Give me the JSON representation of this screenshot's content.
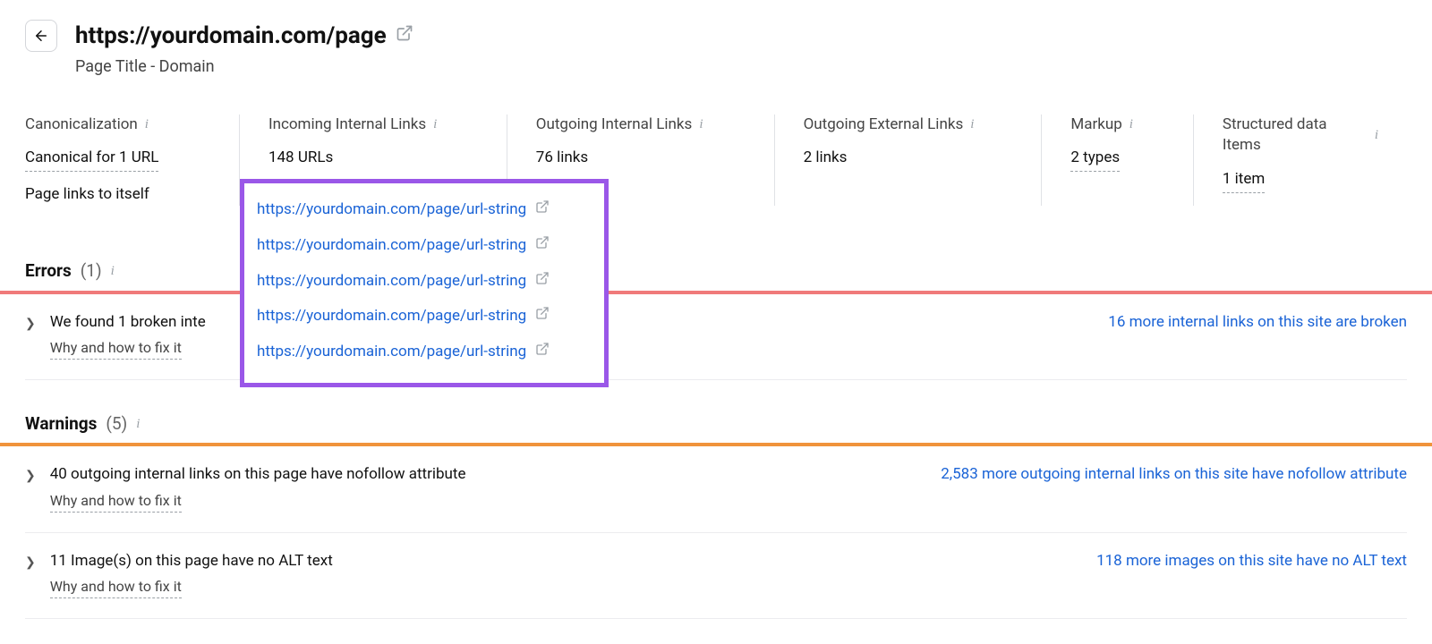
{
  "header": {
    "url": "https://yourdomain.com/page",
    "subtitle": "Page Title - Domain"
  },
  "stats": {
    "canonicalization": {
      "label": "Canonicalization",
      "value1": "Canonical for 1 URL",
      "value2": "Page links to itself"
    },
    "incoming": {
      "label": "Incoming Internal Links",
      "value": "148 URLs"
    },
    "outgoing_int": {
      "label": "Outgoing Internal Links",
      "value": "76 links"
    },
    "outgoing_ext": {
      "label": "Outgoing External Links",
      "value": "2 links"
    },
    "markup": {
      "label": "Markup",
      "value": "2 types"
    },
    "structured": {
      "label": "Structured data Items",
      "value": "1 item"
    }
  },
  "dropdown_links": [
    "https://yourdomain.com/page/url-string",
    "https://yourdomain.com/page/url-string",
    "https://yourdomain.com/page/url-string",
    "https://yourdomain.com/page/url-string",
    "https://yourdomain.com/page/url-string"
  ],
  "sections": {
    "errors": {
      "title": "Errors",
      "count": "(1)"
    },
    "warnings": {
      "title": "Warnings",
      "count": "(5)"
    }
  },
  "issues": {
    "help_text": "Why and how to fix it",
    "error1": {
      "text": "We found 1 broken inte",
      "more": "16 more internal links on this site are broken"
    },
    "warn1": {
      "text": "40 outgoing internal links on this page have nofollow attribute",
      "more": "2,583 more outgoing internal links on this site have nofollow attribute"
    },
    "warn2": {
      "text": "11 Image(s) on this page have no ALT text",
      "more": "118 more images on this site have no ALT text"
    }
  }
}
